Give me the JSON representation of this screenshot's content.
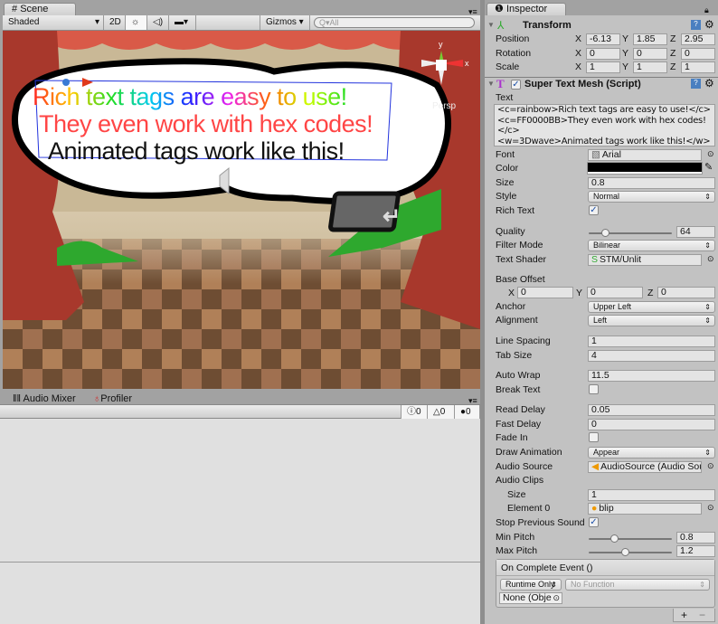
{
  "scene": {
    "tab": "Scene",
    "shading": "Shaded",
    "mode_2d": "2D",
    "gizmos": "Gizmos",
    "search_placeholder": "All",
    "persp": "Persp",
    "bubble_lines": [
      "Rich text tags are easy to use!",
      "They even work with hex codes!",
      "Animated tags work like this!"
    ]
  },
  "bottom": {
    "tabs": [
      "Audio Mixer",
      "Profiler"
    ],
    "counts": {
      "info": "0",
      "warn": "0",
      "error": "0"
    }
  },
  "inspector": {
    "tab": "Inspector",
    "transform": {
      "title": "Transform",
      "position": {
        "label": "Position",
        "x": "-6.13",
        "y": "1.85",
        "z": "2.95"
      },
      "rotation": {
        "label": "Rotation",
        "x": "0",
        "y": "0",
        "z": "0"
      },
      "scale": {
        "label": "Scale",
        "x": "1",
        "y": "1",
        "z": "1"
      }
    },
    "stm": {
      "title": "Super Text Mesh (Script)",
      "text_label": "Text",
      "text_value": "<c=rainbow>Rich text tags are easy to use!</c>\n<c=FF0000BB>They even work with hex codes!</c>\n<w=3Dwave>Animated tags work like this!</w>",
      "font_label": "Font",
      "font": "Arial",
      "color_label": "Color",
      "color": "#000000",
      "size_label": "Size",
      "size": "0.8",
      "style_label": "Style",
      "style": "Normal",
      "rich_label": "Rich Text",
      "quality_label": "Quality",
      "quality": "64",
      "quality_fraction": 0.2,
      "filter_label": "Filter Mode",
      "filter": "Bilinear",
      "shader_label": "Text Shader",
      "shader": "STM/Unlit",
      "base_offset_label": "Base Offset",
      "bo": {
        "x": "0",
        "y": "0",
        "z": "0"
      },
      "anchor_label": "Anchor",
      "anchor": "Upper Left",
      "align_label": "Alignment",
      "align": "Left",
      "linespacing_label": "Line Spacing",
      "linespacing": "1",
      "tabsize_label": "Tab Size",
      "tabsize": "4",
      "autowrap_label": "Auto Wrap",
      "autowrap": "11.5",
      "breaktext_label": "Break Text",
      "readdelay_label": "Read Delay",
      "readdelay": "0.05",
      "fastdelay_label": "Fast Delay",
      "fastdelay": "0",
      "fadein_label": "Fade In",
      "drawanim_label": "Draw Animation",
      "drawanim": "Appear",
      "audiosource_label": "Audio Source",
      "audiosource": "AudioSource (Audio Sou",
      "audioclips_label": "Audio Clips",
      "clips_size_label": "Size",
      "clips_size": "1",
      "element0_label": "Element 0",
      "element0": "blip",
      "stopprev_label": "Stop Previous Sound",
      "minpitch_label": "Min Pitch",
      "minpitch": "0.8",
      "maxpitch_label": "Max Pitch",
      "maxpitch": "1.2",
      "event_title": "On Complete Event ()",
      "runtime": "Runtime Only",
      "nofunc": "No Function",
      "none_obj": "None (Obje",
      "plus": "+",
      "minus": "−"
    },
    "axes": {
      "x": "X",
      "y": "Y",
      "z": "Z"
    }
  }
}
